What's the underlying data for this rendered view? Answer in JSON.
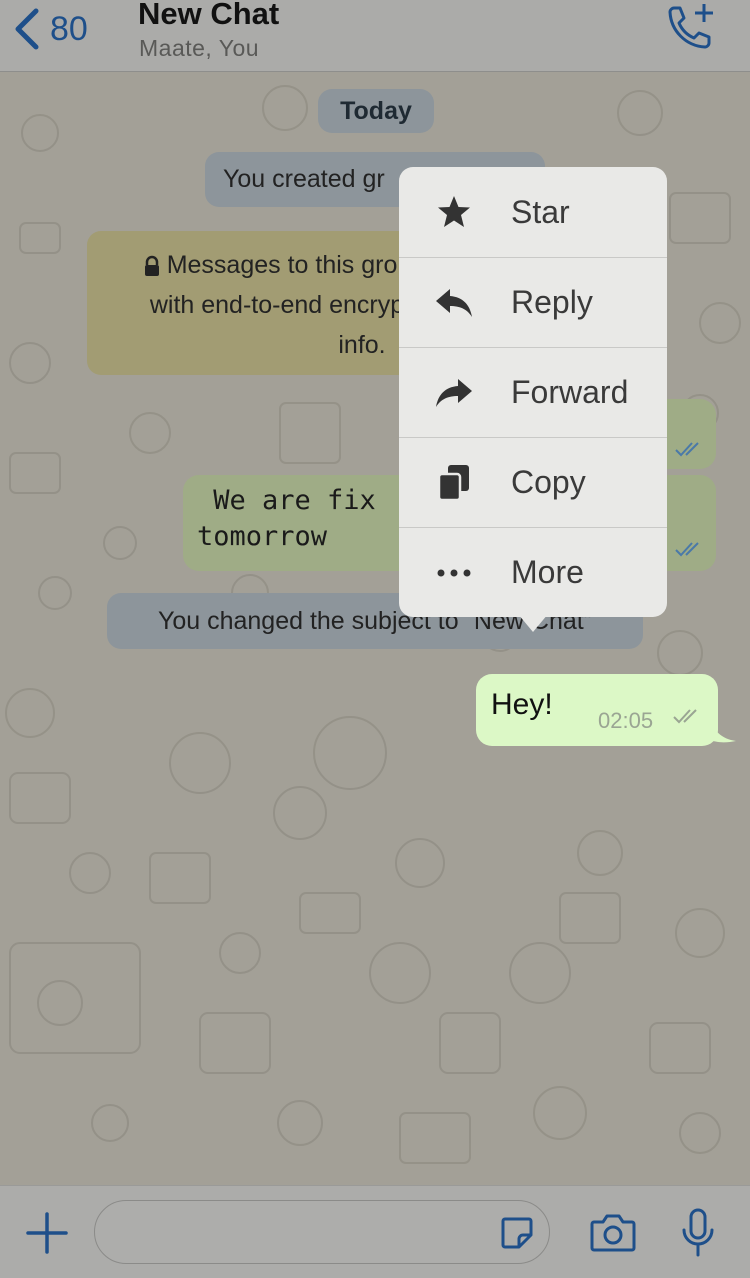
{
  "header": {
    "back_count": "80",
    "title": "New Chat",
    "subtitle": "Maate, You"
  },
  "chat": {
    "date_label": "Today",
    "created_group": "You created gr",
    "encryption_lines": [
      "Messages to this grou",
      "with end-to-end encryp",
      "info."
    ],
    "fixed_message_lines": [
      " We are fix",
      "tomorrow"
    ],
    "changed_subject": "You changed the subject to “New Chat”",
    "last_message": {
      "text": "Hey!",
      "time": "02:05"
    }
  },
  "menu": {
    "items": [
      {
        "label": "Star",
        "icon": "star-icon"
      },
      {
        "label": "Reply",
        "icon": "reply-icon"
      },
      {
        "label": "Forward",
        "icon": "forward-icon"
      },
      {
        "label": "Copy",
        "icon": "copy-icon"
      },
      {
        "label": "More",
        "icon": "more-icon"
      }
    ]
  },
  "colors": {
    "accent": "#1e4f8a",
    "menu_bg": "#e9e9e7",
    "outgoing_bubble": "#dcf8c6"
  }
}
